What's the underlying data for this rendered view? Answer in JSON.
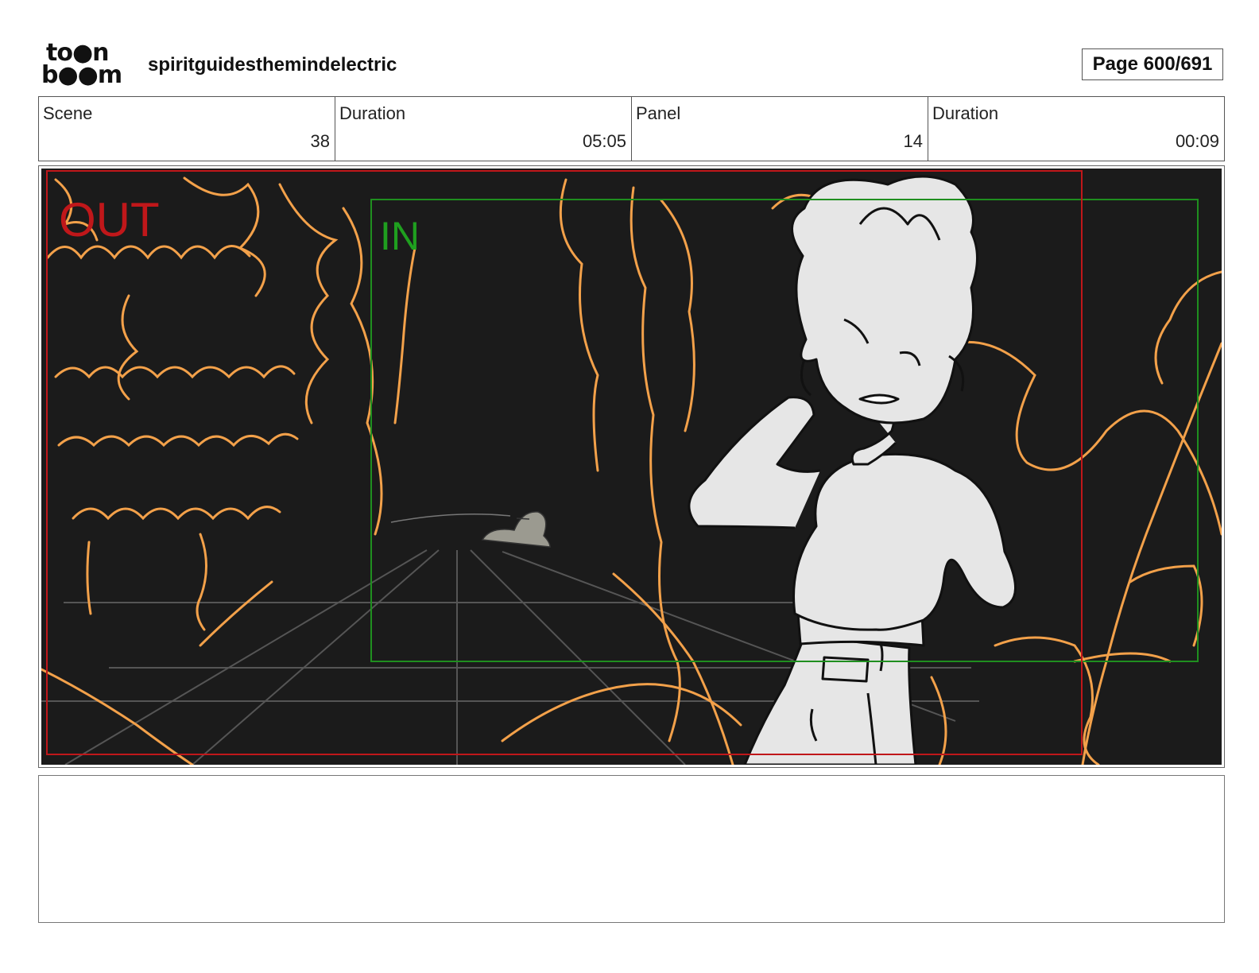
{
  "brand": {
    "logo_line1": "to●n",
    "logo_line2": "b●●m",
    "logo_text": "toon boom"
  },
  "header": {
    "project_title": "spiritguidesthemindelectric",
    "page_label": "Page 600/691"
  },
  "info": {
    "scene_label": "Scene",
    "scene_value": "38",
    "scene_duration_label": "Duration",
    "scene_duration_value": "05:05",
    "panel_label": "Panel",
    "panel_value": "14",
    "panel_duration_label": "Duration",
    "panel_duration_value": "00:09"
  },
  "frame": {
    "out_label": "OUT",
    "in_label": "IN"
  },
  "colors": {
    "background": "#1b1b1b",
    "sketch": "#f3a14a",
    "out_frame": "#c0171a",
    "in_frame": "#1f8f1f",
    "character": "#e6e6e6"
  }
}
